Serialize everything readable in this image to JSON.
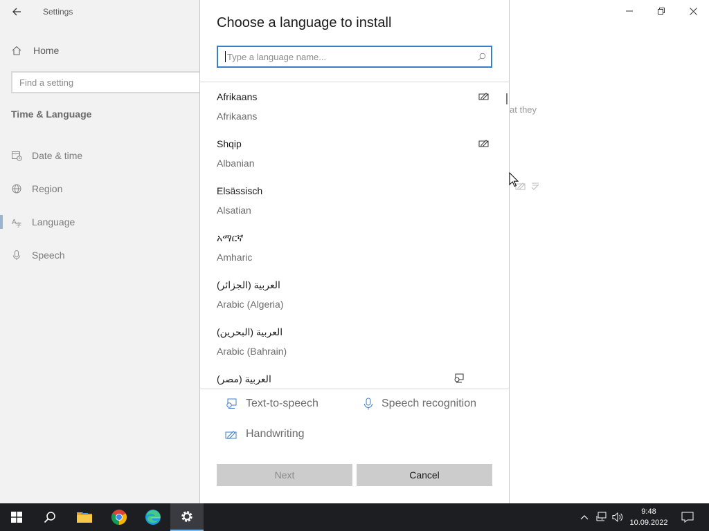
{
  "settings": {
    "app_title": "Settings",
    "home_label": "Home",
    "search_placeholder": "Find a setting",
    "section_title": "Time & Language",
    "nav": [
      {
        "label": "Date & time",
        "icon": "calendar-clock-icon"
      },
      {
        "label": "Region",
        "icon": "globe-icon"
      },
      {
        "label": "Language",
        "icon": "language-icon"
      },
      {
        "label": "Speech",
        "icon": "microphone-icon"
      }
    ],
    "selected_nav": "Language",
    "partial_text": "at they"
  },
  "dialog": {
    "title": "Choose a language to install",
    "search_placeholder": "Type a language name...",
    "languages": [
      {
        "native": "Afrikaans",
        "english": "Afrikaans",
        "features": [
          "handwriting-icon"
        ]
      },
      {
        "native": "Shqip",
        "english": "Albanian",
        "features": [
          "handwriting-icon"
        ]
      },
      {
        "native": "Elsässisch",
        "english": "Alsatian",
        "features": []
      },
      {
        "native": "አማርኛ",
        "english": "Amharic",
        "features": []
      },
      {
        "native": "العربية (الجزائر)",
        "english": "Arabic (Algeria)",
        "features": []
      },
      {
        "native": "العربية (البحرين)",
        "english": "Arabic (Bahrain)",
        "features": []
      },
      {
        "native": "العربية (مصر)",
        "english": "",
        "features": [
          "text-to-speech-icon"
        ]
      }
    ],
    "features": {
      "tts": "Text-to-speech",
      "speech": "Speech recognition",
      "handwriting": "Handwriting"
    },
    "buttons": {
      "next": "Next",
      "cancel": "Cancel"
    }
  },
  "taskbar": {
    "time": "9:48",
    "date": "10.09.2022",
    "apps": [
      "start-icon",
      "search-icon",
      "file-explorer-icon",
      "chrome-icon",
      "edge-icon",
      "settings-icon"
    ],
    "active_app": "settings-icon"
  },
  "colors": {
    "accent": "#3b7dc4",
    "taskbar": "#1d1e22",
    "sidebar": "#f2f2f2"
  }
}
